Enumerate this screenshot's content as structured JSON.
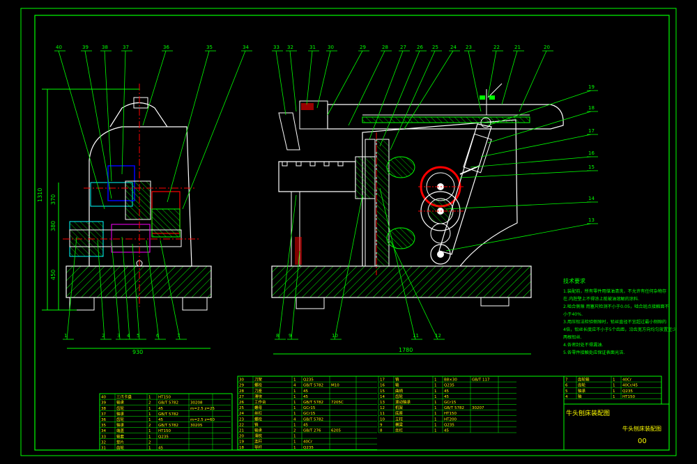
{
  "drawing": {
    "title_cn": "牛头刨床装配图",
    "title_block_name": "牛头刨床装配图",
    "drawing_number": "00",
    "colors": {
      "frame": "#00ff00",
      "outline": "#ffffff",
      "hatch": "#00ff00",
      "leader": "#00ff00",
      "center": "#ff0000",
      "part_red": "#ff0000",
      "part_blue": "#0000ff",
      "part_cyan": "#00ffff",
      "part_magenta": "#ff00ff",
      "notes_text": "#00ff00",
      "table_text": "#ffff00"
    }
  },
  "left_view": {
    "dims": {
      "total_height": "1310",
      "upper": "370",
      "middle": "380",
      "lower": "450",
      "width": "930"
    },
    "balloons_top": [
      "40",
      "39",
      "38",
      "37",
      "36",
      "35",
      "34"
    ],
    "balloons_bottom": [
      "1",
      "2",
      "3",
      "4",
      "5",
      "6",
      "7"
    ]
  },
  "right_view": {
    "dims": {
      "width": "1780"
    },
    "balloons_top": [
      "33",
      "32",
      "31",
      "30",
      "29",
      "28",
      "27",
      "26",
      "25",
      "24",
      "23",
      "22",
      "21",
      "20"
    ],
    "balloons_right": [
      "19",
      "18",
      "17",
      "16",
      "15",
      "14",
      "13"
    ],
    "balloons_bottom": [
      "8",
      "9",
      "10",
      "11",
      "12"
    ]
  },
  "tech_notes": {
    "heading": "技术要求",
    "lines": [
      "1.装配前，所有零件用煤油清洗，不允许有任何杂物存",
      "在.内腔壁上不得涂上能被油溶解的涂料.",
      "2.啮合侧隙 用塞尺检测不小于0.05，啮合斑点接触面不",
      "小于40%.",
      "3.用压铅法检验侧隙时，铅丝直径不宜超过最小侧隙的",
      "4倍，铅丝长度应不小于5个齿距，沿齿宽方向均匀放置至少",
      "两根铅丝.",
      "4.各密封处不得漏油.",
      "5.各零件接触处应保证表面光洁."
    ]
  },
  "parts_table": {
    "left_rows": [
      {
        "no": "40",
        "name": "三爪卡盘",
        "qty": "1",
        "material": "HT150",
        "std": "",
        "note": ""
      },
      {
        "no": "39",
        "name": "轴承",
        "qty": "2",
        "material": "GB/T 5782",
        "std": "30208",
        "note": ""
      },
      {
        "no": "38",
        "name": "齿轮",
        "qty": "1",
        "material": "45",
        "std": "m=2.5 z=25",
        "note": ""
      },
      {
        "no": "37",
        "name": "轴承",
        "qty": "1",
        "material": "GB/T 5782",
        "std": "",
        "note": ""
      },
      {
        "no": "36",
        "name": "齿轮",
        "qty": "1",
        "material": "45",
        "std": "m=2.5 z=60",
        "note": ""
      },
      {
        "no": "35",
        "name": "轴承",
        "qty": "2",
        "material": "GB/T 5782",
        "std": "30205",
        "note": ""
      },
      {
        "no": "34",
        "name": "端盖",
        "qty": "1",
        "material": "HT150",
        "std": "",
        "note": ""
      },
      {
        "no": "33",
        "name": "轴套",
        "qty": "1",
        "material": "Q235",
        "std": "",
        "note": ""
      },
      {
        "no": "32",
        "name": "垫片",
        "qty": "2",
        "material": "",
        "std": "",
        "note": ""
      },
      {
        "no": "31",
        "name": "齿轮",
        "qty": "1",
        "material": "45",
        "std": "",
        "note": ""
      }
    ],
    "mid_rows": [
      {
        "no": "30",
        "name": "刀架",
        "qty": "1",
        "material": "Q235",
        "std": "",
        "note": ""
      },
      {
        "no": "29",
        "name": "螺栓",
        "qty": "4",
        "material": "GB/T 5782",
        "std": "M10",
        "note": ""
      },
      {
        "no": "28",
        "name": "刀座",
        "qty": "1",
        "material": "45",
        "std": "",
        "note": ""
      },
      {
        "no": "27",
        "name": "滑块",
        "qty": "1",
        "material": "45",
        "std": "",
        "note": ""
      },
      {
        "no": "26",
        "name": "工作台",
        "qty": "1",
        "material": "GB/T 5782",
        "std": "7205C",
        "note": ""
      },
      {
        "no": "25",
        "name": "螺母",
        "qty": "1",
        "material": "GCr15",
        "std": "",
        "note": ""
      },
      {
        "no": "24",
        "name": "丝杠",
        "qty": "1",
        "material": "GCr15",
        "std": "",
        "note": ""
      },
      {
        "no": "23",
        "name": "螺栓",
        "qty": "4",
        "material": "GB/T 5782",
        "std": "",
        "note": ""
      },
      {
        "no": "22",
        "name": "销",
        "qty": "1",
        "material": "45",
        "std": "",
        "note": ""
      },
      {
        "no": "21",
        "name": "轴承",
        "qty": "2",
        "material": "GB/T 276",
        "std": "6205",
        "note": ""
      },
      {
        "no": "20",
        "name": "滑枕",
        "qty": "1",
        "material": "",
        "std": "",
        "note": ""
      },
      {
        "no": "19",
        "name": "连杆",
        "qty": "1",
        "material": "40Cr",
        "std": "",
        "note": ""
      },
      {
        "no": "18",
        "name": "导杆",
        "qty": "1",
        "material": "Q235",
        "std": "",
        "note": ""
      }
    ],
    "right_rows": [
      {
        "no": "17",
        "name": "销",
        "qty": "1",
        "material": "B8×30",
        "std": "GB/T 117",
        "note": ""
      },
      {
        "no": "16",
        "name": "轴",
        "qty": "1",
        "material": "Q235",
        "std": "",
        "note": ""
      },
      {
        "no": "15",
        "name": "曲柄",
        "qty": "1",
        "material": "45",
        "std": "",
        "note": ""
      },
      {
        "no": "14",
        "name": "齿轮",
        "qty": "1",
        "material": "45",
        "std": "",
        "note": ""
      },
      {
        "no": "13",
        "name": "滚动轴承",
        "qty": "1",
        "material": "GCr15",
        "std": "",
        "note": ""
      },
      {
        "no": "12",
        "name": "机架",
        "qty": "1",
        "material": "GB/T 5782",
        "std": "30207",
        "note": ""
      },
      {
        "no": "11",
        "name": "底座",
        "qty": "1",
        "material": "HT150",
        "std": "",
        "note": ""
      },
      {
        "no": "10",
        "name": "立柱",
        "qty": "1",
        "material": "HT200",
        "std": "",
        "note": ""
      },
      {
        "no": "9",
        "name": "横梁",
        "qty": "1",
        "material": "Q235",
        "std": "",
        "note": ""
      },
      {
        "no": "8",
        "name": "丝杠",
        "qty": "1",
        "material": "45",
        "std": "",
        "note": ""
      }
    ],
    "far_rows": [
      {
        "no": "7",
        "name": "齿轮轴",
        "qty": "1",
        "material": "40Cr"
      },
      {
        "no": "6",
        "name": "齿轮",
        "qty": "1",
        "material": "40Cr/45"
      },
      {
        "no": "5",
        "name": "轴承",
        "qty": "1",
        "material": "Q235"
      },
      {
        "no": "4",
        "name": "轴",
        "qty": "1",
        "material": "HT150"
      }
    ],
    "header": {
      "no": "序号",
      "name": "名称",
      "qty": "数量",
      "material": "材料",
      "note": "备注"
    },
    "title_block": {
      "title": "牛头刨床装配图",
      "sub": "牛头刨床装配图",
      "labels": [
        "标记",
        "处数",
        "分区",
        "更改文件号",
        "签名",
        "年月日"
      ],
      "labels2": [
        "设计",
        "标准化",
        "阶段标记",
        "重量",
        "比例"
      ],
      "drawing_no": "00",
      "scale": "1:2"
    }
  }
}
